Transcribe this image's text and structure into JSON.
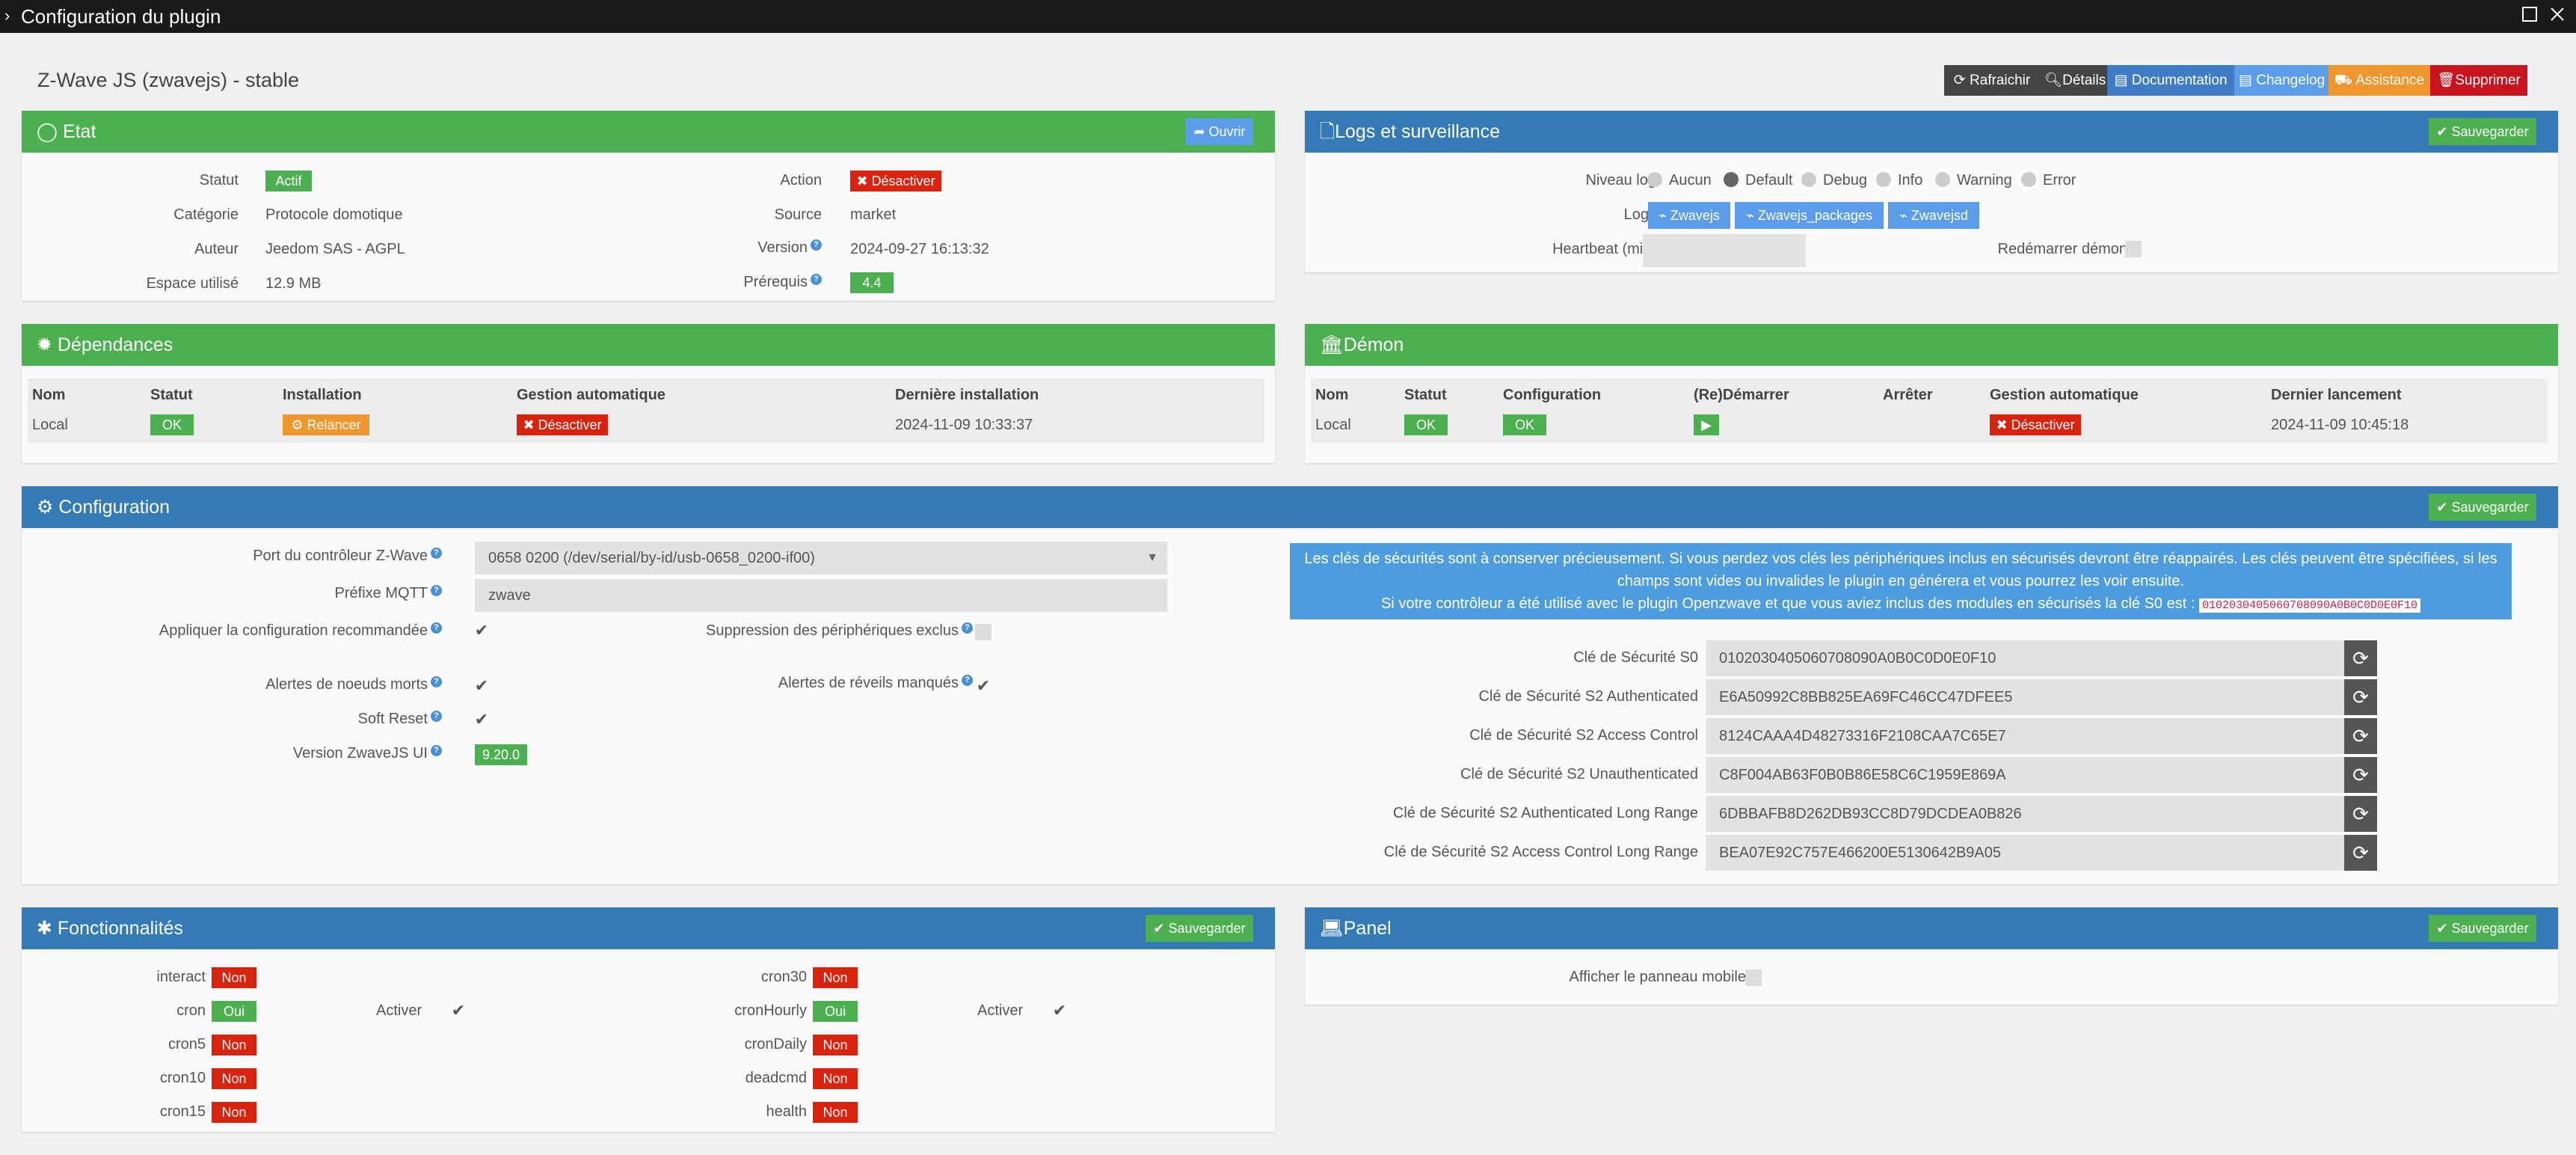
{
  "window": {
    "title": "Configuration du plugin"
  },
  "page_title": "Z-Wave JS (zwavejs) - stable",
  "toolbar": {
    "refresh": "Rafraichir",
    "details": "Détails",
    "documentation": "Documentation",
    "changelog": "Changelog",
    "assistance": "Assistance",
    "delete": "Supprimer"
  },
  "etat": {
    "title": "Etat",
    "open_btn": "Ouvrir",
    "statut_label": "Statut",
    "statut_value": "Actif",
    "categorie_label": "Catégorie",
    "categorie_value": "Protocole domotique",
    "auteur_label": "Auteur",
    "auteur_value": "Jeedom SAS - AGPL",
    "espace_label": "Espace utilisé",
    "espace_value": "12.9 MB",
    "action_label": "Action",
    "action_btn": "Désactiver",
    "source_label": "Source",
    "source_value": "market",
    "version_label": "Version",
    "version_value": "2024-09-27 16:13:32",
    "prerequis_label": "Prérequis",
    "prerequis_value": "4.4"
  },
  "logs": {
    "title": "Logs et surveillance",
    "save": "Sauvegarder",
    "niveau_label": "Niveau log",
    "levels": [
      "Aucun",
      "Default",
      "Debug",
      "Info",
      "Warning",
      "Error"
    ],
    "selected_level": "Default",
    "logs_label": "Logs",
    "log_buttons": [
      "Zwavejs",
      "Zwavejs_packages",
      "Zwavejsd"
    ],
    "heartbeat_label": "Heartbeat (min)",
    "heartbeat_value": "",
    "restart_label": "Redémarrer démon"
  },
  "dependances": {
    "title": "Dépendances",
    "headers": [
      "Nom",
      "Statut",
      "Installation",
      "Gestion automatique",
      "Dernière installation"
    ],
    "row": {
      "nom": "Local",
      "statut": "OK",
      "installation": "Relancer",
      "gestion": "Désactiver",
      "derniere": "2024-11-09 10:33:37"
    }
  },
  "demon": {
    "title": "Démon",
    "headers": [
      "Nom",
      "Statut",
      "Configuration",
      "(Re)Démarrer",
      "Arrêter",
      "Gestion automatique",
      "Dernier lancement"
    ],
    "row": {
      "nom": "Local",
      "statut": "OK",
      "configuration": "OK",
      "gestion": "Désactiver",
      "dernier": "2024-11-09 10:45:18"
    }
  },
  "configuration": {
    "title": "Configuration",
    "save": "Sauvegarder",
    "port_label": "Port du contrôleur Z-Wave",
    "port_value": "0658 0200 (/dev/serial/by-id/usb-0658_0200-if00)",
    "mqtt_label": "Préfixe MQTT",
    "mqtt_value": "zwave",
    "apply_label": "Appliquer la configuration recommandée",
    "suppression_label": "Suppression des périphériques exclus",
    "alertes_noeuds_label": "Alertes de noeuds morts",
    "alertes_reveils_label": "Alertes de réveils manqués",
    "soft_reset_label": "Soft Reset",
    "version_ui_label": "Version ZwaveJS UI",
    "version_ui_value": "9.20.0",
    "info_line1": "Les clés de sécurités sont à conserver précieusement. Si vous perdez vos clés les périphériques inclus en sécurisés devront être réappairés. Les clés peuvent être spécifiées, si les",
    "info_line2": "champs sont vides ou invalides le plugin en générera et vous pourrez les voir ensuite.",
    "info_line3": "Si votre contrôleur a été utilisé avec le plugin Openzwave et que vous aviez inclus des modules en sécurisés la clé S0 est :",
    "info_code": "0102030405060708090A0B0C0D0E0F10",
    "keys": [
      {
        "label": "Clé de Sécurité S0",
        "value": "0102030405060708090A0B0C0D0E0F10"
      },
      {
        "label": "Clé de Sécurité S2 Authenticated",
        "value": "E6A50992C8BB825EA69FC46CC47DFEE5"
      },
      {
        "label": "Clé de Sécurité S2 Access Control",
        "value": "8124CAAA4D48273316F2108CAA7C65E7"
      },
      {
        "label": "Clé de Sécurité S2 Unauthenticated",
        "value": "C8F004AB63F0B0B86E58C6C1959E869A"
      },
      {
        "label": "Clé de Sécurité S2 Authenticated Long Range",
        "value": "6DBBAFB8D262DB93CC8D79DCDEA0B826"
      },
      {
        "label": "Clé de Sécurité S2 Access Control Long Range",
        "value": "BEA07E92C757E466200E5130642B9A05"
      }
    ]
  },
  "fonctionnalites": {
    "title": "Fonctionnalités",
    "save": "Sauvegarder",
    "activer_label": "Activer",
    "left": [
      {
        "name": "interact",
        "value": "Non"
      },
      {
        "name": "cron",
        "value": "Oui"
      },
      {
        "name": "cron5",
        "value": "Non"
      },
      {
        "name": "cron10",
        "value": "Non"
      },
      {
        "name": "cron15",
        "value": "Non"
      }
    ],
    "right": [
      {
        "name": "cron30",
        "value": "Non"
      },
      {
        "name": "cronHourly",
        "value": "Oui"
      },
      {
        "name": "cronDaily",
        "value": "Non"
      },
      {
        "name": "deadcmd",
        "value": "Non"
      },
      {
        "name": "health",
        "value": "Non"
      }
    ]
  },
  "panel": {
    "title": "Panel",
    "save": "Sauvegarder",
    "mobile_label": "Afficher le panneau mobile"
  },
  "colors": {
    "green": "#4caf50",
    "blue": "#337ab7",
    "red": "#d9230f",
    "orange": "#f0962e"
  }
}
